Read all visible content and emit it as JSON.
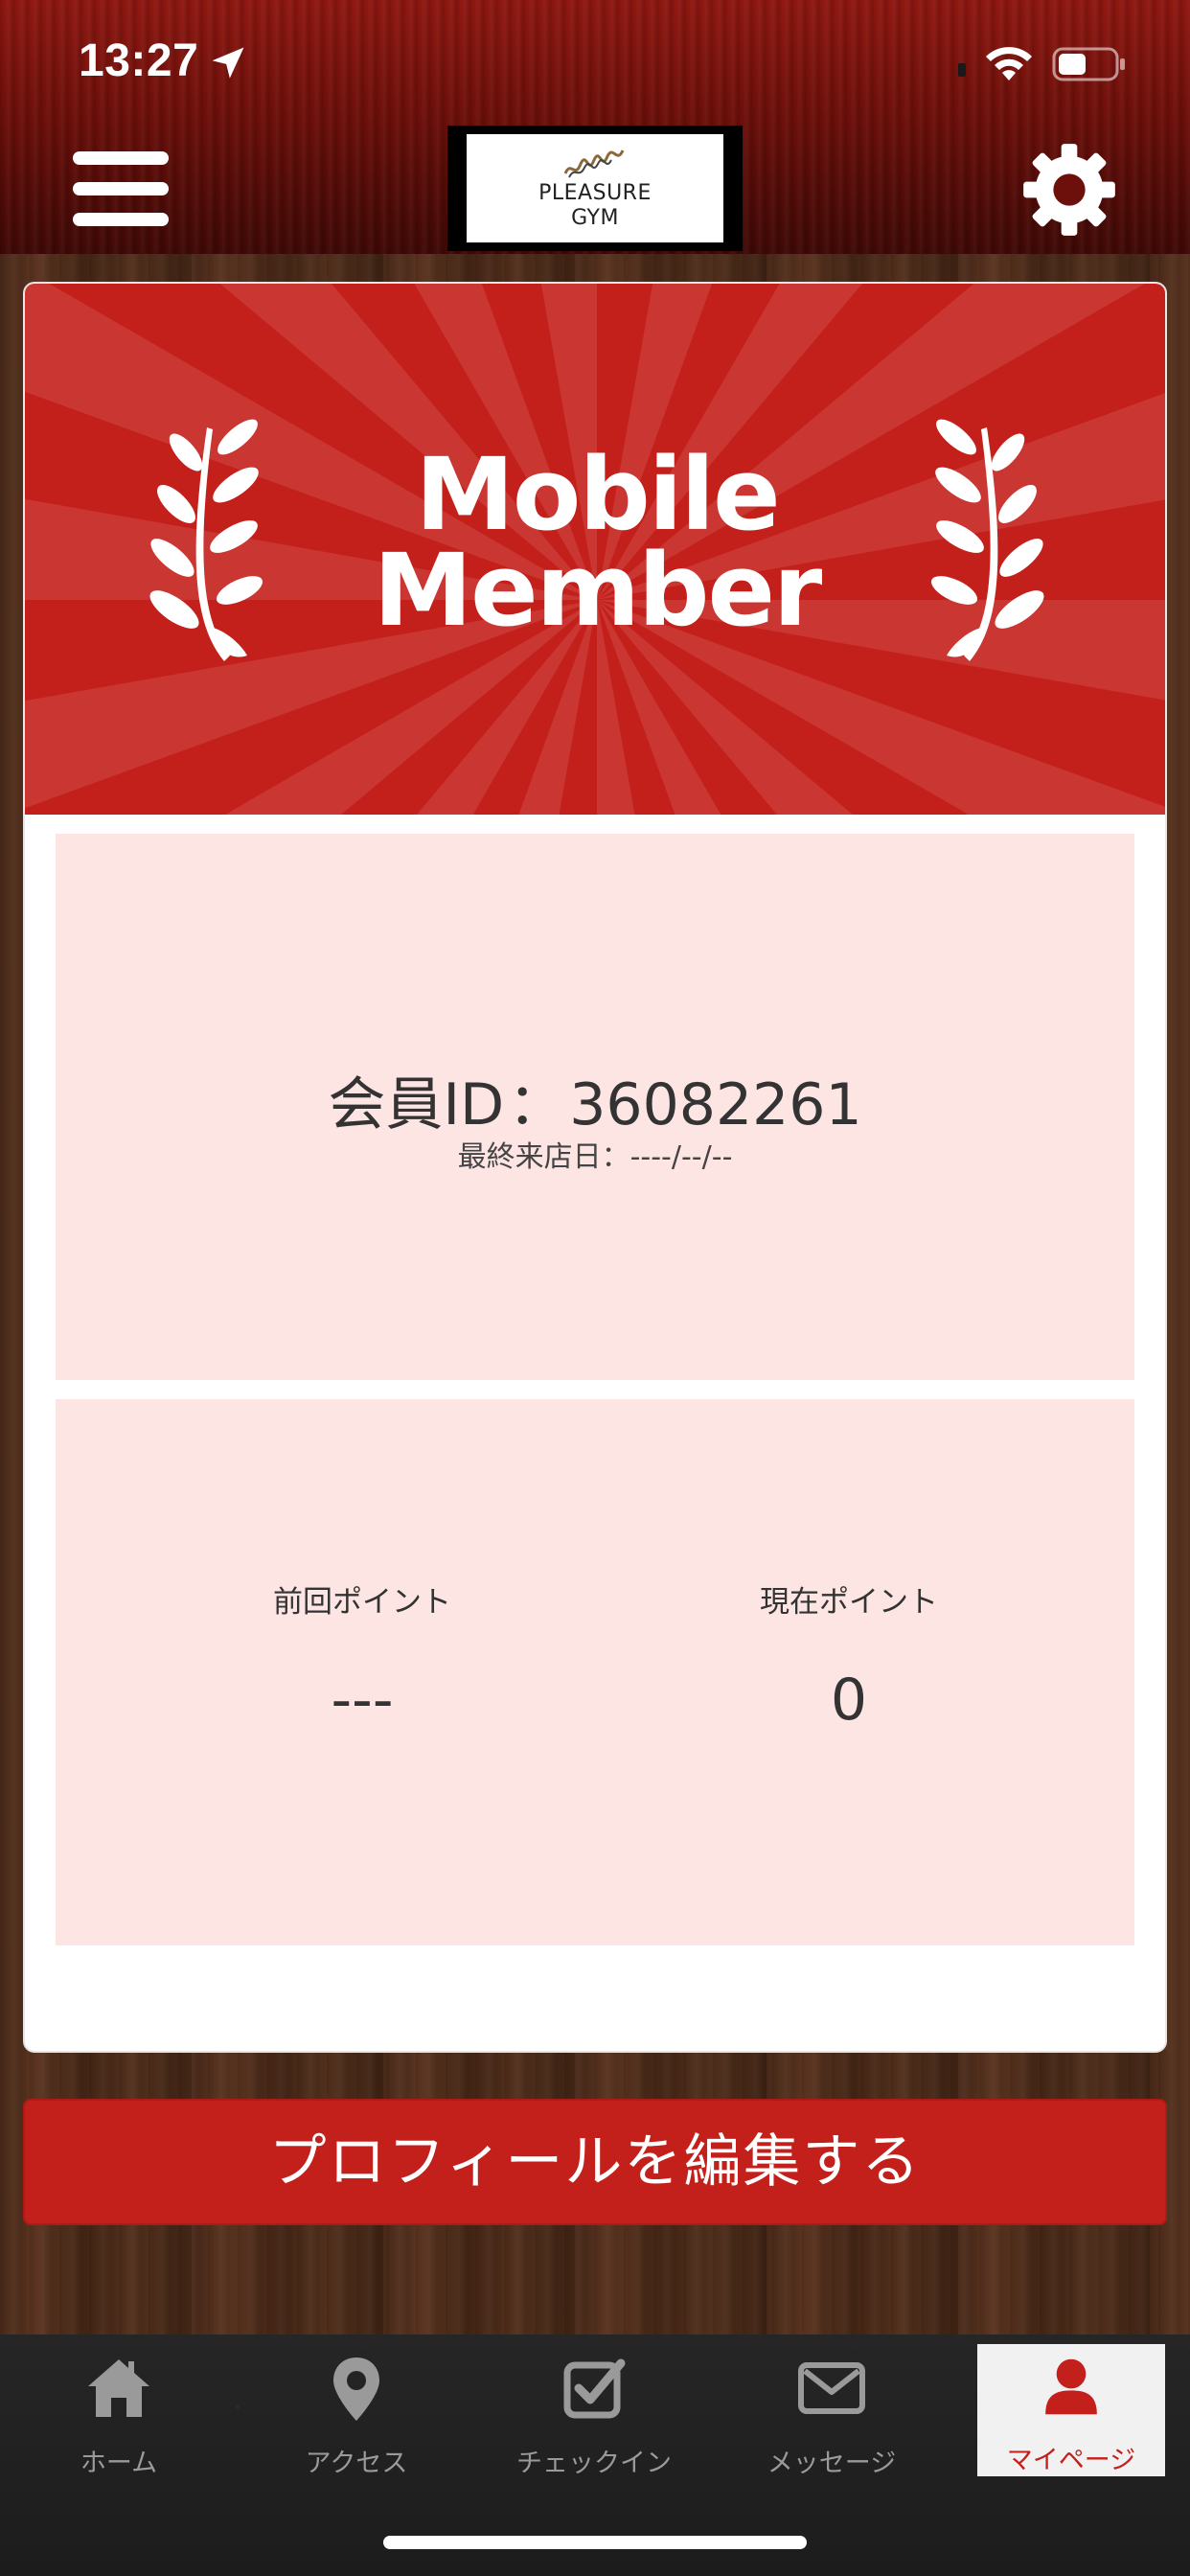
{
  "status_bar": {
    "time": "13:27",
    "icons": [
      "location-arrow-icon",
      "wifi-icon",
      "battery-icon"
    ]
  },
  "header": {
    "menu_icon": "hamburger-menu-icon",
    "logo_line1": "PLEASURE",
    "logo_line2": "GYM",
    "settings_icon": "gear-icon"
  },
  "banner": {
    "title_line1": "Mobile",
    "title_line2": "Member",
    "decoration": "laurel-icon"
  },
  "member": {
    "id_label": "会員ID",
    "id_separator": "：",
    "id_value": "36082261",
    "last_visit_label": "最終来店日：",
    "last_visit_value": "----/--/--"
  },
  "points": {
    "previous_label": "前回ポイント",
    "previous_value": "---",
    "current_label": "現在ポイント",
    "current_value": "0"
  },
  "edit_button_label": "プロフィールを編集する",
  "tabbar": {
    "tabs": [
      {
        "label": "ホーム",
        "icon": "home-icon"
      },
      {
        "label": "アクセス",
        "icon": "map-pin-icon"
      },
      {
        "label": "チェックイン",
        "icon": "checkbox-icon"
      },
      {
        "label": "メッセージ",
        "icon": "envelope-icon"
      },
      {
        "label": "マイページ",
        "icon": "user-icon"
      }
    ],
    "active_index": 4
  },
  "colors": {
    "accent_red": "#c4201b",
    "panel_pink": "#fde5e4",
    "header_red": "#8e1710"
  }
}
